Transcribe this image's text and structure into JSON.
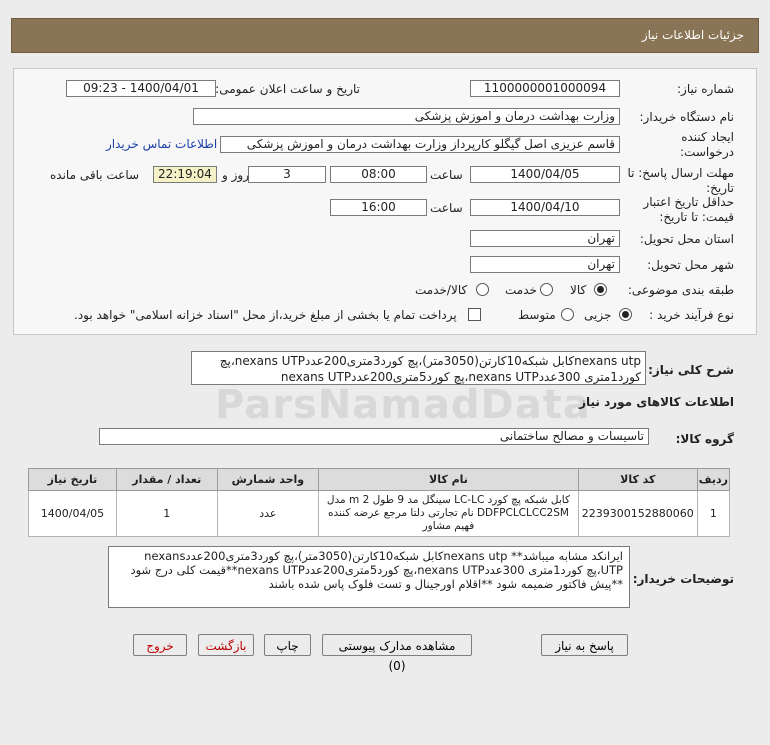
{
  "header": {
    "title": "جزئیات اطلاعات نیاز"
  },
  "fields": {
    "need_number_label": "شماره نیاز:",
    "need_number": "1100000001000094",
    "announce_label": "تاریخ و ساعت اعلان عمومی:",
    "announce_value": "1400/04/01 - 09:23",
    "buyer_org_label": "نام دستگاه خریدار:",
    "buyer_org": "وزارت بهداشت  درمان و اموزش پزشکی",
    "creator_label": "ایجاد کننده درخواست:",
    "creator": "قاسم عزیزی اصل گیگلو کارپرداز وزارت بهداشت  درمان و اموزش پزشکی",
    "contact_link": "اطلاعات تماس خریدار",
    "deadline_label": "مهلت ارسال پاسخ: تا تاریخ:",
    "deadline_date": "1400/04/05",
    "time_label": "ساعت",
    "deadline_time": "08:00",
    "days_value": "3",
    "days_label": "روز و",
    "remaining_time": "22:19:04",
    "remaining_label": "ساعت باقی مانده",
    "validity_label": "حداقل تاریخ اعتبار قیمت: تا تاریخ:",
    "validity_date": "1400/04/10",
    "validity_time": "16:00",
    "province_label": "استان محل تحویل:",
    "province": "تهران",
    "city_label": "شهر محل تحویل:",
    "city": "تهران",
    "category_label": "طبقه بندی موضوعی:",
    "category_options": [
      "کالا",
      "خدمت",
      "کالا/خدمت"
    ],
    "process_label": "نوع فرآیند خرید :",
    "process_options": [
      "جزیی",
      "متوسط"
    ],
    "payment_note": "پرداخت تمام یا بخشی از مبلغ خرید،از محل \"اسناد خزانه اسلامی\" خواهد بود."
  },
  "summary": {
    "label": "شرح کلی نیاز:",
    "text": "nexans utpکابل شبکه10کارتن(3050متر)،پچ کورد3متری200عددnexans UTP،پچ کورد1متری 300عددnexans UTP،پچ کورد5متری200عددnexans UTP"
  },
  "goods_info": {
    "title": "اطلاعات کالاهای مورد نیاز"
  },
  "goods_group": {
    "label": "گروه کالا:",
    "value": "تاسیسات و مصالح ساختمانی"
  },
  "table": {
    "headers": [
      "ردیف",
      "کد کالا",
      "نام کالا",
      "واحد شمارش",
      "تعداد / مقدار",
      "تاریخ نیاز"
    ],
    "rows": [
      {
        "row": "1",
        "code": "2239300152880060",
        "name": "کابل شبکه پچ کورد LC-LC سینگل مد 9 طول 2 m مدل DDFPCLCLCC2SM نام تجارتی دلتا مرجع عرضه کننده فهیم مشاور",
        "unit": "عدد",
        "qty": "1",
        "date": "1400/04/05"
      }
    ]
  },
  "buyer_desc": {
    "label": "توضیحات خریدار:",
    "text": "ایرانکد مشابه میباشد** nexans utpکابل شبکه10کارتن(3050متر)،پچ کورد3متری200عددnexans UTP،پچ کورد1متری 300عددnexans UTP،پچ کورد5متری200عددnexans UTP**قیمت کلی درج شود **پیش فاکتور ضمیمه شود **اقلام اورجینال و تست فلوک پاس شده باشند"
  },
  "buttons": {
    "reply": "پاسخ به نیاز",
    "attachments": "مشاهده مدارک پیوستی (0)",
    "print": "چاپ",
    "back": "بازگشت",
    "exit": "خروج"
  },
  "watermark": {
    "brand": "ParsNamadData"
  }
}
